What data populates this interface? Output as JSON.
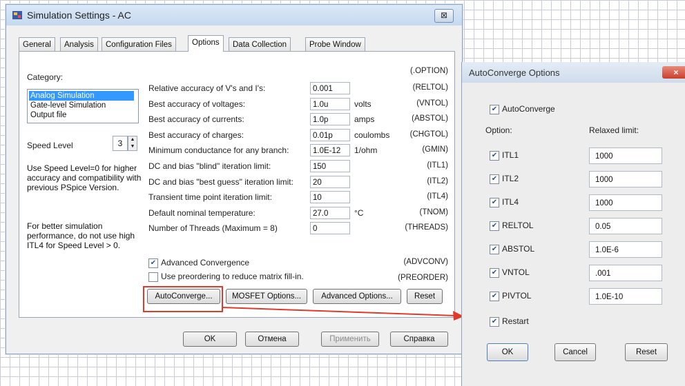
{
  "main_dialog": {
    "title": "Simulation Settings - AC",
    "close_label": "⊠",
    "tabs": [
      {
        "label": "General"
      },
      {
        "label": "Analysis"
      },
      {
        "label": "Configuration Files"
      },
      {
        "label": "Options"
      },
      {
        "label": "Data Collection"
      },
      {
        "label": "Probe Window"
      }
    ],
    "category_label": "Category:",
    "category_items": [
      "Analog Simulation",
      "Gate-level Simulation",
      "Output file"
    ],
    "speed_level_label": "Speed Level",
    "speed_level_value": "3",
    "note1": "Use Speed Level=0 for higher accuracy and compatibility with previous PSpice Version.",
    "note2": "For better simulation performance, do not use high ITL4 for Speed Level > 0.",
    "option_header": "(.OPTION)",
    "options": [
      {
        "label": "Relative accuracy of V's and I's:",
        "value": "0.001",
        "unit": "",
        "code": "(RELTOL)"
      },
      {
        "label": "Best accuracy of voltages:",
        "value": "1.0u",
        "unit": "volts",
        "code": "(VNTOL)"
      },
      {
        "label": "Best accuracy of currents:",
        "value": "1.0p",
        "unit": "amps",
        "code": "(ABSTOL)"
      },
      {
        "label": "Best accuracy of charges:",
        "value": "0.01p",
        "unit": "coulombs",
        "code": "(CHGTOL)"
      },
      {
        "label": "Minimum conductance for any branch:",
        "value": "1.0E-12",
        "unit": "1/ohm",
        "code": "(GMIN)"
      },
      {
        "label": "DC and bias \"blind\" iteration limit:",
        "value": "150",
        "unit": "",
        "code": "(ITL1)"
      },
      {
        "label": "DC and bias \"best guess\" iteration limit:",
        "value": "20",
        "unit": "",
        "code": "(ITL2)"
      },
      {
        "label": "Transient time point iteration limit:",
        "value": "10",
        "unit": "",
        "code": "(ITL4)"
      },
      {
        "label": "Default nominal temperature:",
        "value": "27.0",
        "unit": "°C",
        "code": "(TNOM)"
      },
      {
        "label": "Number of Threads (Maximum = 8)",
        "value": "0",
        "unit": "",
        "code": "(THREADS)"
      }
    ],
    "adv_conv_label": "Advanced Convergence",
    "adv_conv_code": "(ADVCONV)",
    "adv_conv_checked": true,
    "preorder_label": "Use preordering to reduce matrix fill-in.",
    "preorder_code": "(PREORDER)",
    "preorder_checked": false,
    "buttons": {
      "autoconverge": "AutoConverge...",
      "mosfet": "MOSFET Options...",
      "advanced": "Advanced Options...",
      "reset": "Reset"
    },
    "footer_buttons": {
      "ok": "OK",
      "cancel": "Отмена",
      "apply": "Применить",
      "help": "Справка"
    },
    "highlight_color": "#e03a2a"
  },
  "autoconverge_dialog": {
    "title": "AutoConverge Options",
    "close_label": "×",
    "autoconverge_label": "AutoConverge",
    "autoconverge_checked": true,
    "col_option": "Option:",
    "col_relaxed": "Relaxed limit:",
    "rows": [
      {
        "label": "ITL1",
        "value": "1000",
        "checked": true
      },
      {
        "label": "ITL2",
        "value": "1000",
        "checked": true
      },
      {
        "label": "ITL4",
        "value": "1000",
        "checked": true
      },
      {
        "label": "RELTOL",
        "value": "0.05",
        "checked": true
      },
      {
        "label": "ABSTOL",
        "value": "1.0E-6",
        "checked": true
      },
      {
        "label": "VNTOL",
        "value": ".001",
        "checked": true
      },
      {
        "label": "PIVTOL",
        "value": "1.0E-10",
        "checked": true
      }
    ],
    "restart_label": "Restart",
    "restart_checked": true,
    "buttons": {
      "ok": "OK",
      "cancel": "Cancel",
      "reset": "Reset"
    }
  }
}
